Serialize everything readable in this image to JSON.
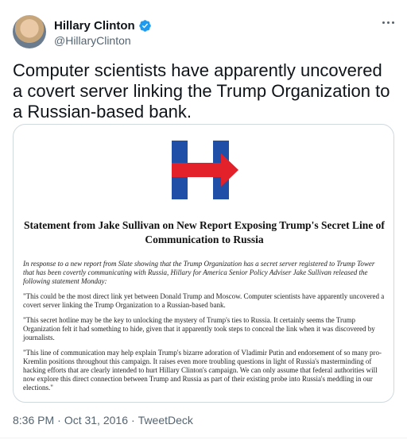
{
  "author": {
    "name": "Hillary Clinton",
    "handle": "@HillaryClinton",
    "verified": true
  },
  "tweet": {
    "text": "Computer scientists have apparently uncovered a covert server linking the Trump Organization to a Russian-based bank."
  },
  "card": {
    "logo": "hillary-h-arrow-logo",
    "title": "Statement from Jake Sullivan on New Report Exposing Trump's Secret Line of Communication to Russia",
    "paragraphs": [
      "In response to a new report from Slate showing that the Trump Organization has a secret server registered to Trump Tower that has been covertly communicating with Russia, Hillary for America Senior Policy Adviser Jake Sullivan released the following statement Monday:",
      "\"This could be the most direct link yet between Donald Trump and Moscow. Computer scientists have apparently uncovered a covert server linking the Trump Organization to a Russian-based bank.",
      "\"This secret hotline may be the key to unlocking the mystery of Trump's ties to Russia. It certainly seems the Trump Organization felt it had something to hide, given that it apparently took steps to conceal the link when it was discovered by journalists.",
      "\"This line of communication may help explain Trump's bizarre adoration of Vladimir Putin and endorsement of so many pro-Kremlin positions throughout this campaign. It raises even more troubling questions in light of Russia's masterminding of hacking efforts that are clearly intended to hurt Hillary Clinton's campaign. We can only assume that federal authorities will now explore this direct connection between Trump and Russia as part of their existing probe into Russia's meddling in our elections.\""
    ]
  },
  "meta": {
    "time": "8:36 PM",
    "date": "Oct 31, 2016",
    "separator": "·",
    "source": "TweetDeck"
  },
  "colors": {
    "verified": "#1d9bf0",
    "logo_blue": "#1f4fa6",
    "logo_red": "#e2212b",
    "muted_text": "#536471"
  }
}
